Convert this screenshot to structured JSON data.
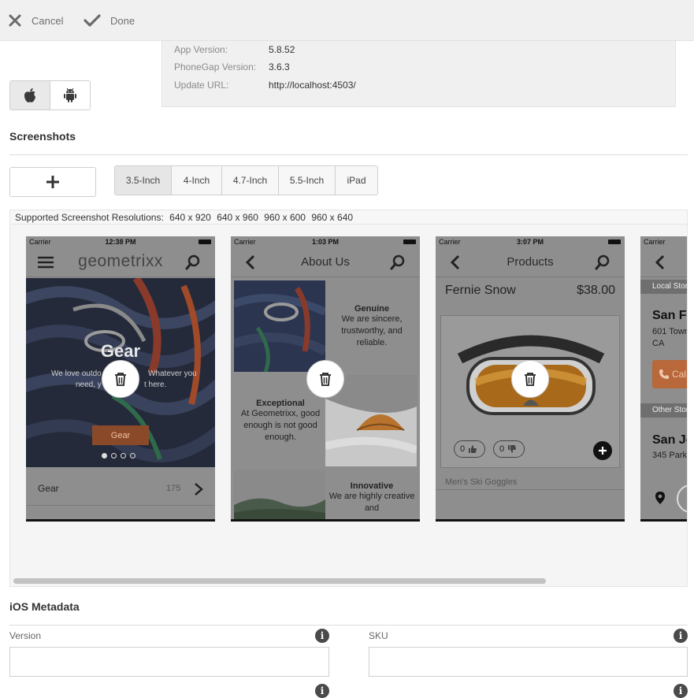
{
  "toolbar": {
    "cancel_label": "Cancel",
    "done_label": "Done"
  },
  "app_info": {
    "app_version_label": "App Version:",
    "app_version_value": "5.8.52",
    "phonegap_version_label": "PhoneGap Version:",
    "phonegap_version_value": "3.6.3",
    "update_url_label": "Update URL:",
    "update_url_value": "http://localhost:4503/"
  },
  "platforms": [
    {
      "name": "ios",
      "icon": "apple-icon",
      "active": true
    },
    {
      "name": "android",
      "icon": "android-icon",
      "active": false
    }
  ],
  "screenshots": {
    "title": "Screenshots",
    "size_tabs": [
      "3.5-Inch",
      "4-Inch",
      "4.7-Inch",
      "5.5-Inch",
      "iPad"
    ],
    "active_tab": "3.5-Inch",
    "resolutions_label": "Supported Screenshot Resolutions:",
    "resolutions": [
      "640 x 920",
      "640 x 960",
      "960 x 600",
      "960 x 640"
    ]
  },
  "phones": [
    {
      "carrier": "Carrier",
      "time": "12:38 PM",
      "title": "geometrixx",
      "hero_title": "Gear",
      "hero_text_left": "We love outdo",
      "hero_text_right": "Whatever you",
      "hero_text2_left": "need, y",
      "hero_text2_right": "t here.",
      "hero_button": "Gear",
      "list_item_label": "Gear",
      "list_item_count": "175"
    },
    {
      "carrier": "Carrier",
      "time": "1:03 PM",
      "title": "About Us",
      "blocks": [
        {
          "heading": "Genuine",
          "text": "We are sincere, trustworthy, and reliable."
        },
        {
          "heading": "Exceptional",
          "text": "At Geometrixx, good enough is not good enough."
        },
        {
          "heading": "Innovative",
          "text": "We are highly creative and"
        }
      ]
    },
    {
      "carrier": "Carrier",
      "time": "3:07 PM",
      "title": "Products",
      "product_name": "Fernie Snow",
      "product_price": "$38.00",
      "likes": "0",
      "dislikes": "0",
      "caption": "Men's Ski Goggles"
    },
    {
      "carrier": "Carrier",
      "section1": "Local Stor",
      "store1_name": "San Fr",
      "store1_addr1": "601 Town",
      "store1_addr2": "CA",
      "call_label": "Cal",
      "section2": "Other Stor",
      "store2_name": "San Jo",
      "store2_addr": "345 Park"
    }
  ],
  "ios_metadata": {
    "title": "iOS Metadata",
    "version_label": "Version",
    "version_value": "",
    "sku_label": "SKU",
    "sku_value": ""
  },
  "colors": {
    "accent_orange": "#c8703f",
    "background_gray": "#f0f0f0",
    "text_dark": "#333333"
  }
}
